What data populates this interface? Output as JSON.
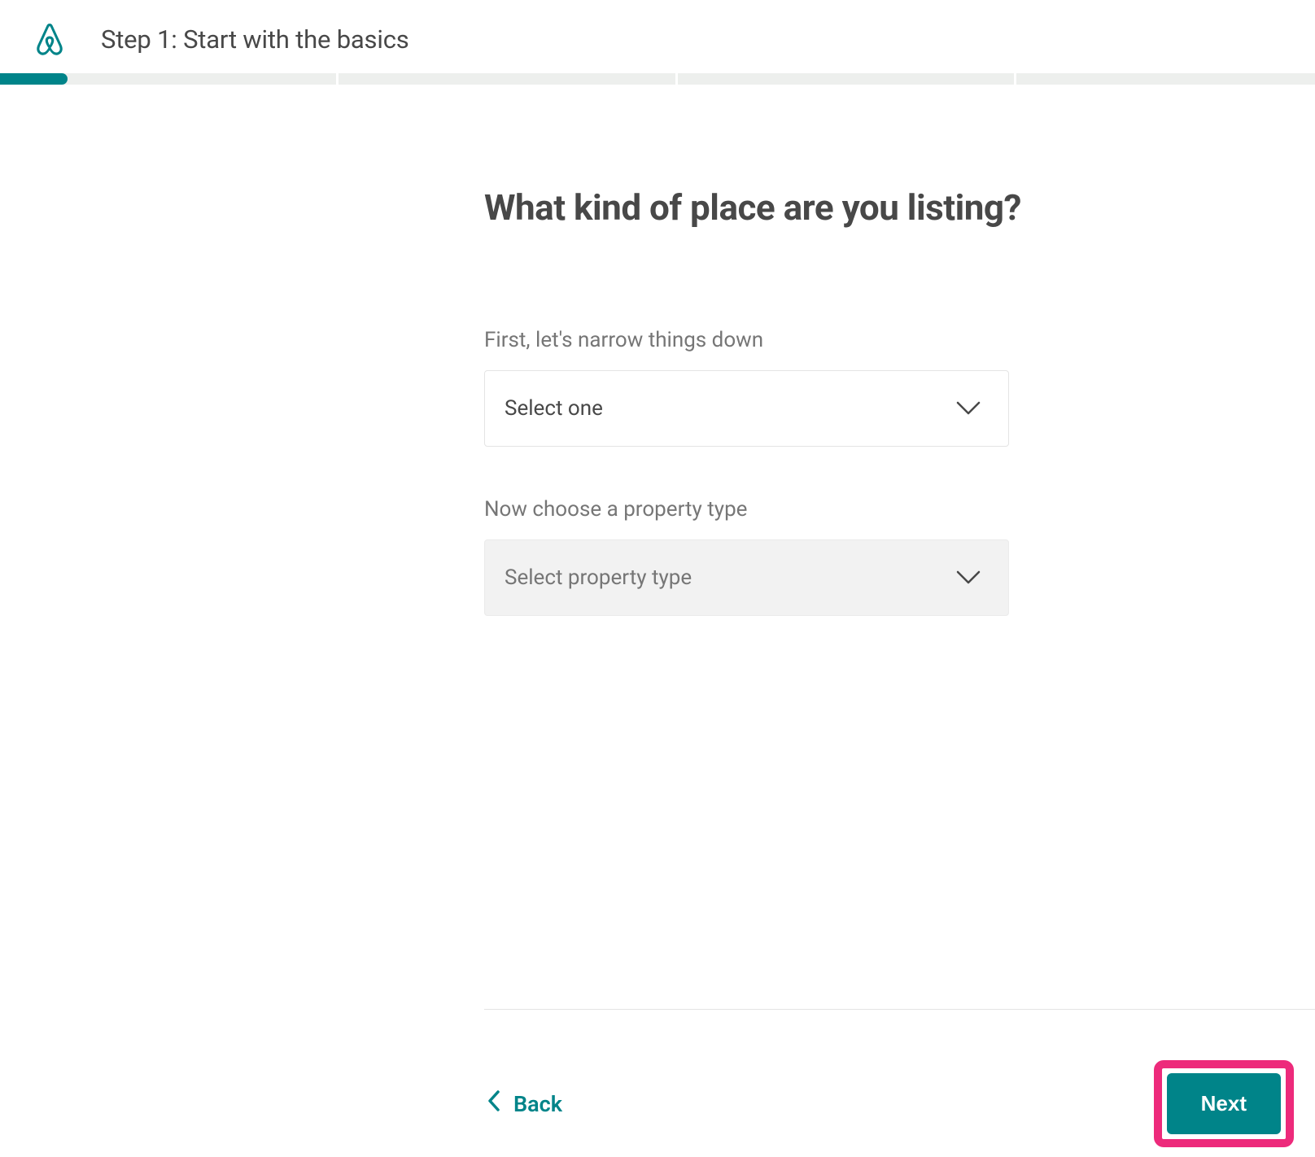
{
  "header": {
    "step_title": "Step 1: Start with the basics"
  },
  "progress": {
    "fill_percent": 20
  },
  "main": {
    "heading": "What kind of place are you listing?",
    "field1": {
      "label": "First, let's narrow things down",
      "value": "Select one"
    },
    "field2": {
      "label": "Now choose a property type",
      "value": "Select property type"
    }
  },
  "footer": {
    "back_label": "Back",
    "next_label": "Next"
  },
  "colors": {
    "brand": "#008489",
    "highlight": "#ed2a7b"
  }
}
